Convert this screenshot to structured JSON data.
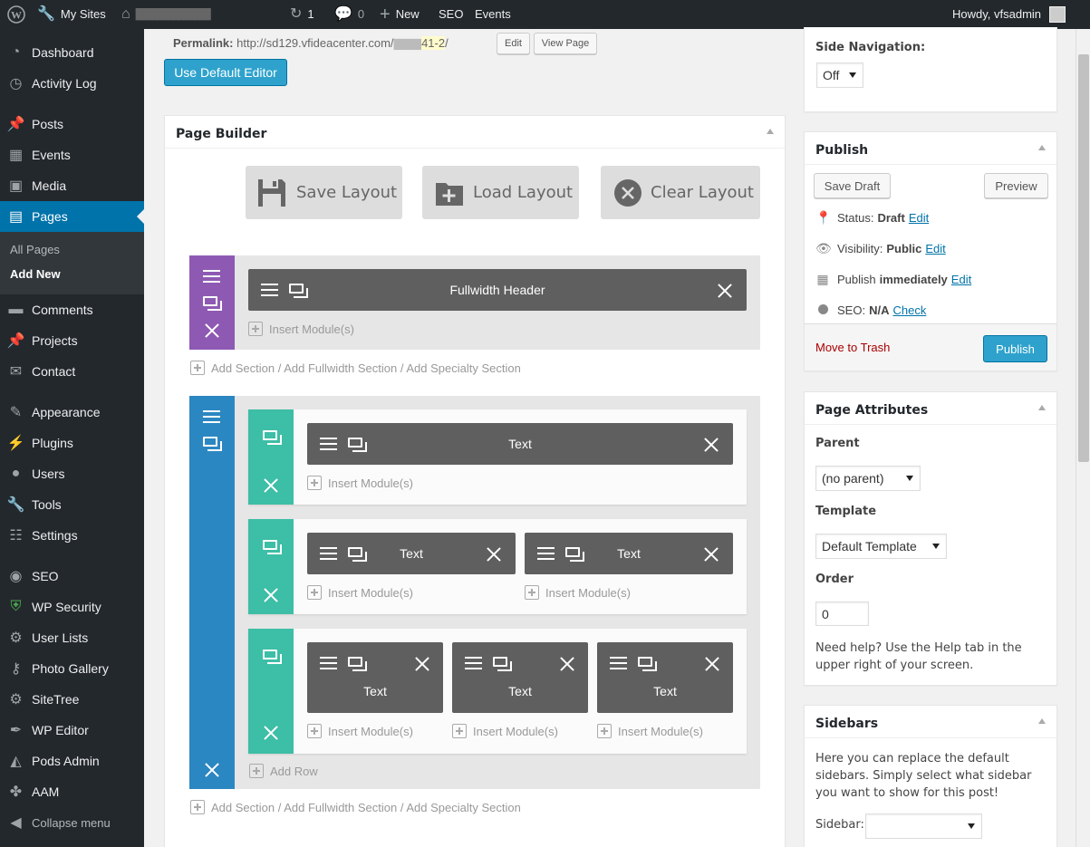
{
  "adminbar": {
    "my_sites": "My Sites",
    "site_name": "██████████████",
    "updates": "1",
    "comments": "0",
    "new": "New",
    "seo": "SEO",
    "events": "Events",
    "howdy": "Howdy, vfsadmin"
  },
  "sidebar": {
    "items": [
      {
        "label": "Dashboard",
        "icon": "dashboard-icon"
      },
      {
        "label": "Activity Log",
        "icon": "history-icon"
      },
      {
        "label": "Posts",
        "icon": "pin-icon"
      },
      {
        "label": "Events",
        "icon": "calendar-icon"
      },
      {
        "label": "Media",
        "icon": "media-icon"
      },
      {
        "label": "Pages",
        "icon": "pages-icon"
      },
      {
        "label": "Comments",
        "icon": "comment-icon"
      },
      {
        "label": "Projects",
        "icon": "pin-icon"
      },
      {
        "label": "Contact",
        "icon": "mail-icon"
      },
      {
        "label": "Appearance",
        "icon": "brush-icon"
      },
      {
        "label": "Plugins",
        "icon": "plugin-icon"
      },
      {
        "label": "Users",
        "icon": "user-icon"
      },
      {
        "label": "Tools",
        "icon": "wrench-icon"
      },
      {
        "label": "Settings",
        "icon": "settings-icon"
      },
      {
        "label": "SEO",
        "icon": "seo-icon"
      },
      {
        "label": "WP Security",
        "icon": "shield-icon"
      },
      {
        "label": "User Lists",
        "icon": "gear-icon"
      },
      {
        "label": "Photo Gallery",
        "icon": "key-icon"
      },
      {
        "label": "SiteTree",
        "icon": "gear-icon"
      },
      {
        "label": "WP Editor",
        "icon": "pen-icon"
      },
      {
        "label": "Pods Admin",
        "icon": "pods-icon"
      },
      {
        "label": "AAM",
        "icon": "aam-icon"
      },
      {
        "label": "Collapse menu",
        "icon": "collapse-icon"
      }
    ],
    "submenu": {
      "all_pages": "All Pages",
      "add_new": "Add New"
    }
  },
  "editor": {
    "permalink_label": "Permalink:",
    "permalink_url_start": "http://sd129.vfideacenter.com/",
    "permalink_url_blur": "██████",
    "permalink_slug": "41-2",
    "permalink_url_end": "/",
    "edit_label": "Edit",
    "view_page_label": "View Page",
    "default_editor_label": "Use Default Editor"
  },
  "builder": {
    "title": "Page Builder",
    "save_layout": "Save Layout",
    "load_layout": "Load Layout",
    "clear_layout": "Clear Layout",
    "fullwidth_module": "Fullwidth Header",
    "module_text": "Text",
    "insert_modules": "Insert Module(s)",
    "add_row": "Add Row",
    "add_section": "Add Section / Add Fullwidth Section / Add Specialty Section",
    "colors": {
      "fullwidth": "#8e59b3",
      "specialty": "#2b87c1",
      "row": "#3dbea6",
      "module": "#5f5f5f"
    }
  },
  "side_nav": {
    "label": "Side Navigation:",
    "value": "Off"
  },
  "publish": {
    "title": "Publish",
    "save_draft": "Save Draft",
    "preview": "Preview",
    "status_label": "Status:",
    "status_value": "Draft",
    "visibility_label": "Visibility:",
    "visibility_value": "Public",
    "publish_label": "Publish",
    "publish_value": "immediately",
    "seo_label": "SEO:",
    "seo_value": "N/A",
    "edit": "Edit",
    "check": "Check",
    "trash": "Move to Trash",
    "publish_button": "Publish"
  },
  "attributes": {
    "title": "Page Attributes",
    "parent_label": "Parent",
    "parent_value": "(no parent)",
    "template_label": "Template",
    "template_value": "Default Template",
    "order_label": "Order",
    "order_value": "0",
    "help_text": "Need help? Use the Help tab in the upper right of your screen."
  },
  "sidebars": {
    "title": "Sidebars",
    "text": "Here you can replace the default sidebars. Simply select what sidebar you want to show for this post!",
    "sidebar_label": "Sidebar:",
    "sidebar_value": ""
  }
}
